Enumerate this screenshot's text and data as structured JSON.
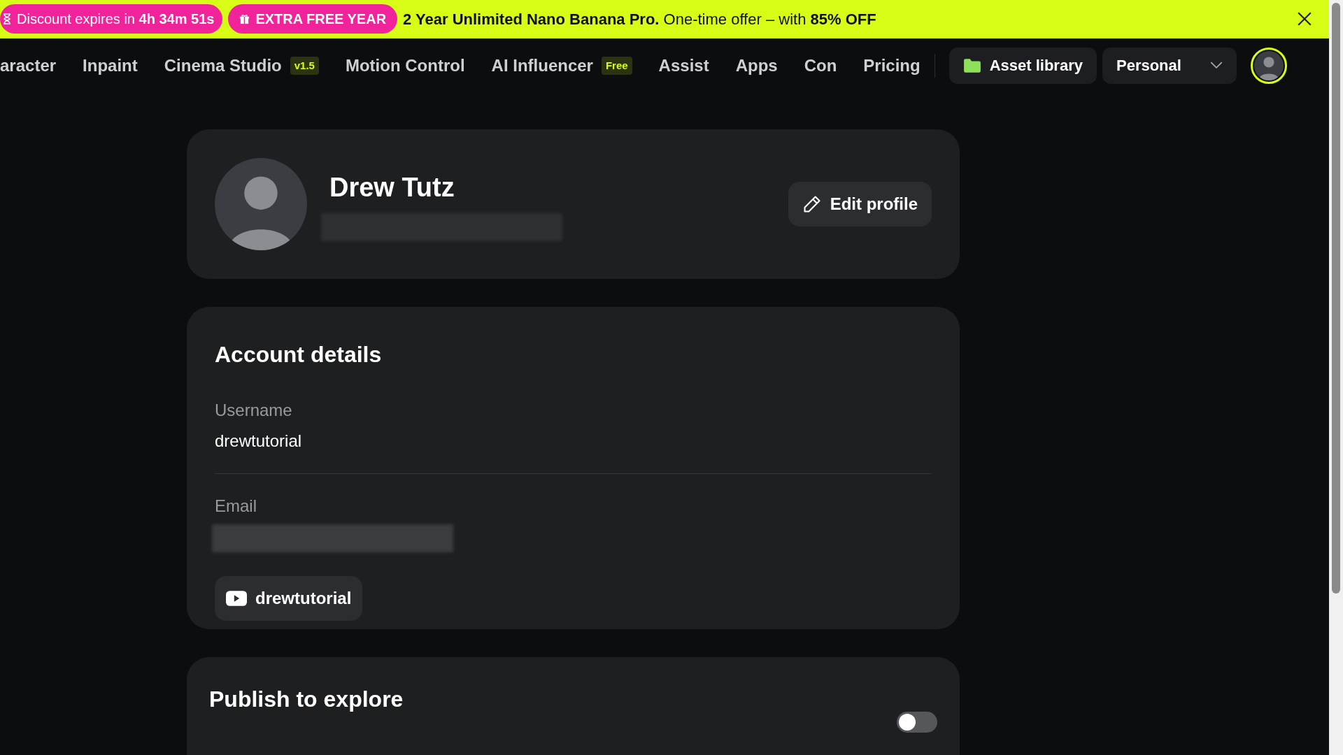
{
  "promo_banner": {
    "timer_badge": "Discount expires in **4h 34m 51s**",
    "offer_badge": "EXTRA FREE YEAR",
    "message": "**2 Year Unlimited Nano Banana Pro.** One-time offer – with **85% OFF**"
  },
  "nav": {
    "items": [
      {
        "label": "aracter"
      },
      {
        "label": "Inpaint"
      },
      {
        "label": "Cinema Studio",
        "badge": "v1.5"
      },
      {
        "label": "Motion Control"
      },
      {
        "label": "AI Influencer",
        "badge": "Free"
      },
      {
        "label": "Assist"
      },
      {
        "label": "Apps"
      },
      {
        "label": "Con"
      },
      {
        "label": "Pricing"
      }
    ],
    "asset_library": "Asset library",
    "workspace": "Personal"
  },
  "profile": {
    "name": "Drew Tutz",
    "edit_button": "Edit profile"
  },
  "account_details": {
    "title": "Account details",
    "fields": [
      {
        "label": "Username",
        "value": "drewtutorial"
      },
      {
        "label": "Email"
      }
    ],
    "youtube_chip": "drewtutorial"
  },
  "publish": {
    "title": "Publish to explore",
    "toggle_on": false
  }
}
